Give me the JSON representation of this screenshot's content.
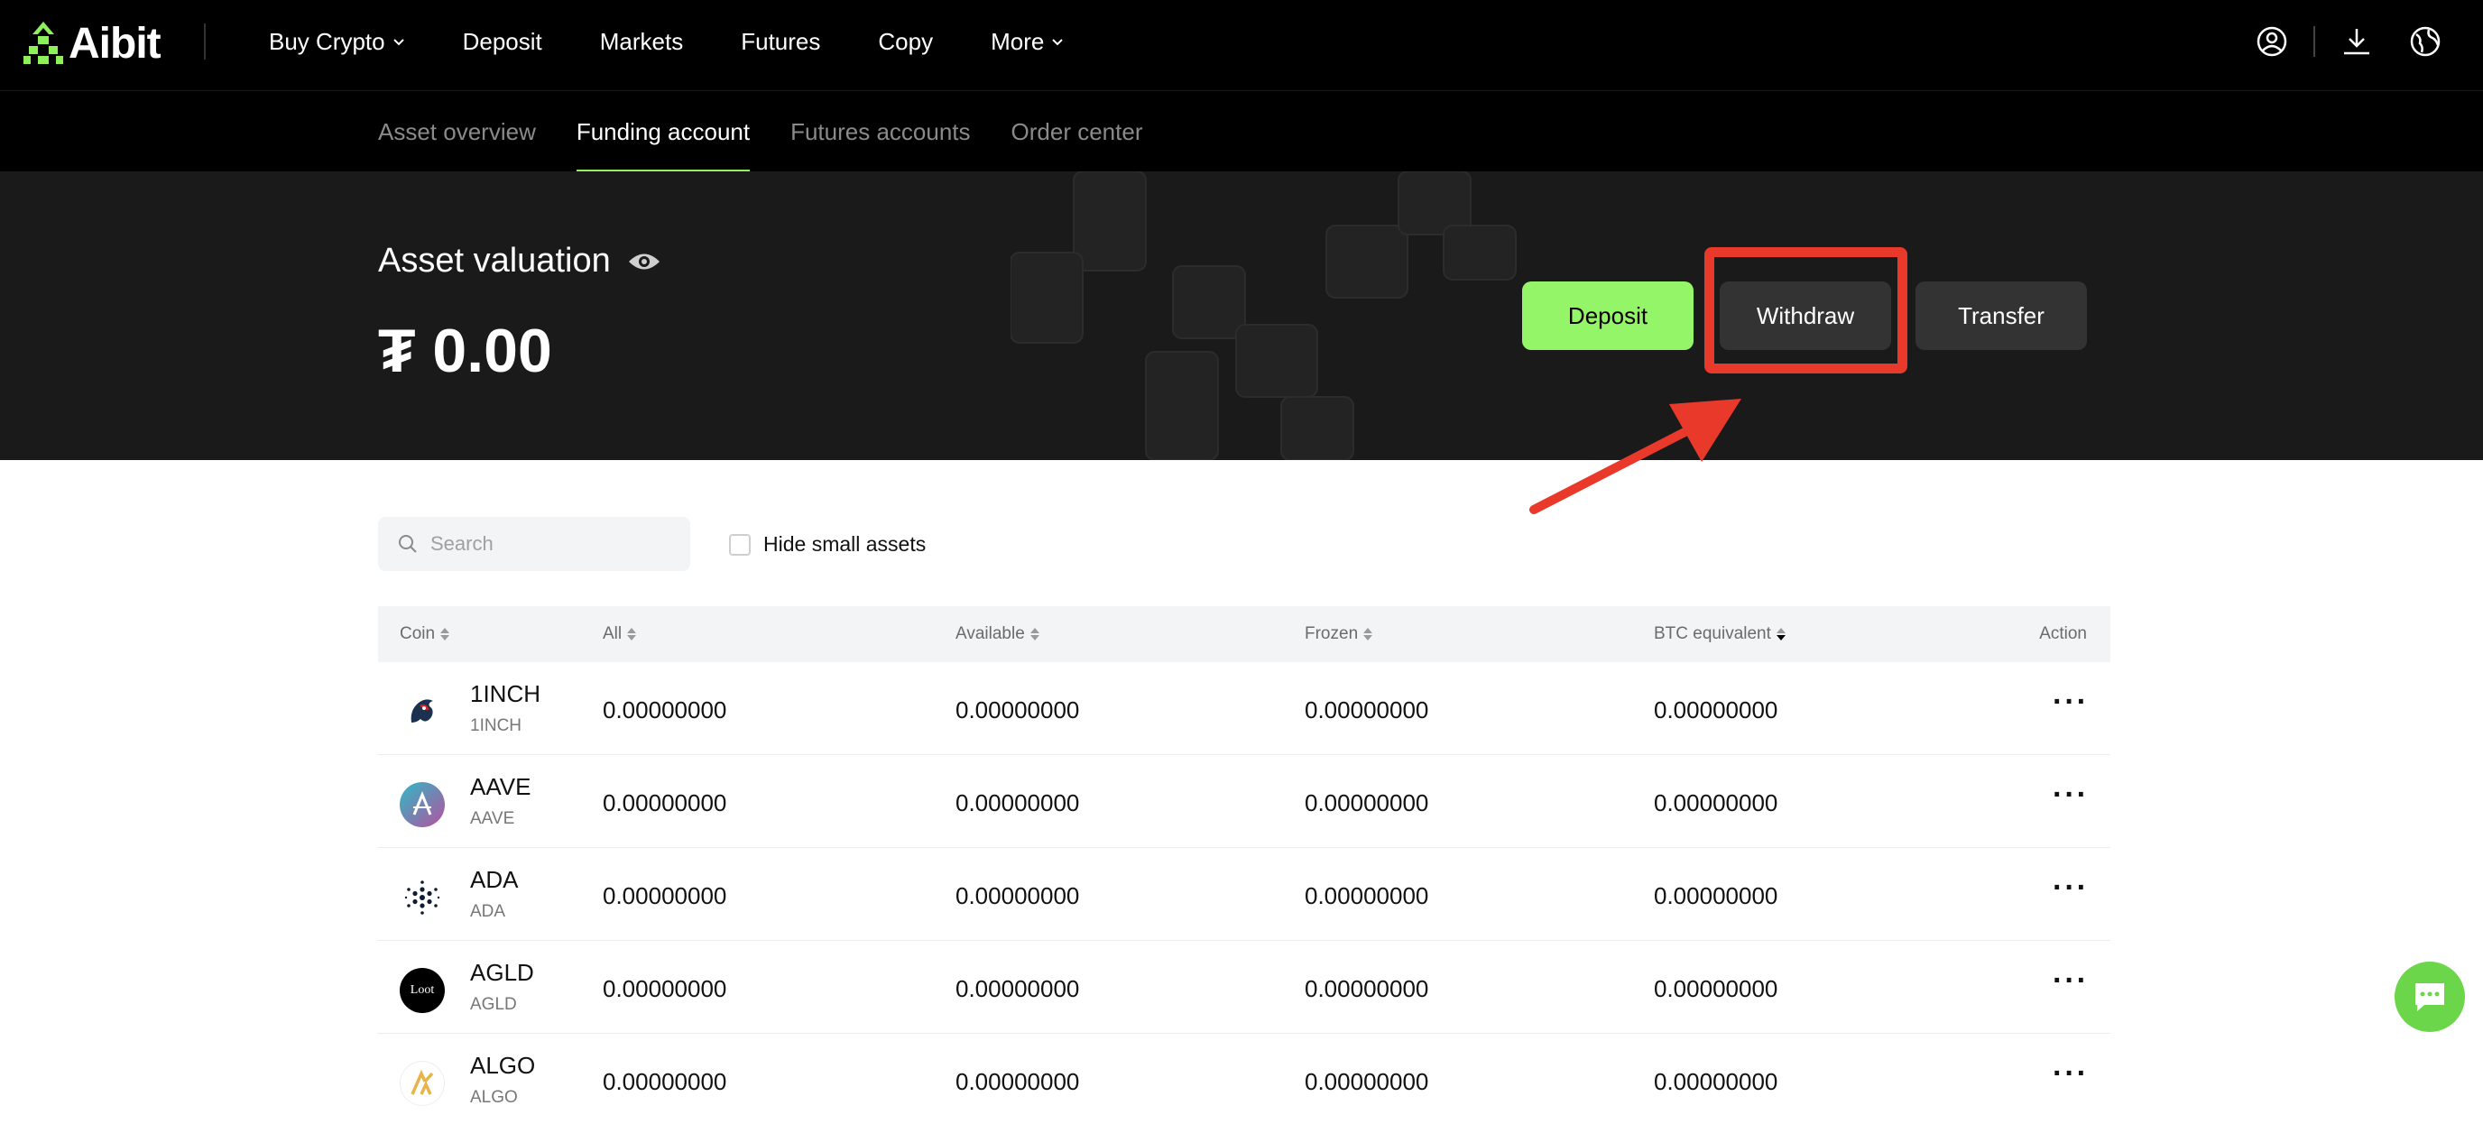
{
  "brand": {
    "name": "Aibit",
    "accent": "#95f568"
  },
  "topnav": {
    "items": [
      {
        "label": "Buy Crypto",
        "dropdown": true
      },
      {
        "label": "Deposit",
        "dropdown": false
      },
      {
        "label": "Markets",
        "dropdown": false
      },
      {
        "label": "Futures",
        "dropdown": false
      },
      {
        "label": "Copy",
        "dropdown": false
      },
      {
        "label": "More",
        "dropdown": true
      }
    ],
    "right_icons": [
      "user-icon",
      "download-icon",
      "globe-icon"
    ]
  },
  "subnav": {
    "tabs": [
      {
        "label": "Asset overview",
        "active": false
      },
      {
        "label": "Funding account",
        "active": true
      },
      {
        "label": "Futures accounts",
        "active": false
      },
      {
        "label": "Order center",
        "active": false
      }
    ]
  },
  "hero": {
    "title": "Asset valuation",
    "value": "₮ 0.00",
    "buttons": {
      "deposit": "Deposit",
      "withdraw": "Withdraw",
      "transfer": "Transfer"
    },
    "annotation_color": "#e8392b"
  },
  "filters": {
    "search_placeholder": "Search",
    "hide_small_label": "Hide small assets",
    "hide_small_checked": false
  },
  "table": {
    "headers": {
      "coin": "Coin",
      "all": "All",
      "available": "Available",
      "frozen": "Frozen",
      "btc": "BTC equivalent",
      "action": "Action"
    },
    "rows": [
      {
        "name": "1INCH",
        "sub": "1INCH",
        "all": "0.00000000",
        "available": "0.00000000",
        "frozen": "0.00000000",
        "btc": "0.00000000",
        "icon": "1inch-coin-icon"
      },
      {
        "name": "AAVE",
        "sub": "AAVE",
        "all": "0.00000000",
        "available": "0.00000000",
        "frozen": "0.00000000",
        "btc": "0.00000000",
        "icon": "aave-coin-icon"
      },
      {
        "name": "ADA",
        "sub": "ADA",
        "all": "0.00000000",
        "available": "0.00000000",
        "frozen": "0.00000000",
        "btc": "0.00000000",
        "icon": "ada-coin-icon"
      },
      {
        "name": "AGLD",
        "sub": "AGLD",
        "all": "0.00000000",
        "available": "0.00000000",
        "frozen": "0.00000000",
        "btc": "0.00000000",
        "icon": "agld-coin-icon",
        "icon_text": "Loot"
      },
      {
        "name": "ALGO",
        "sub": "ALGO",
        "all": "0.00000000",
        "available": "0.00000000",
        "frozen": "0.00000000",
        "btc": "0.00000000",
        "icon": "algo-coin-icon"
      }
    ],
    "action_glyph": "···"
  }
}
